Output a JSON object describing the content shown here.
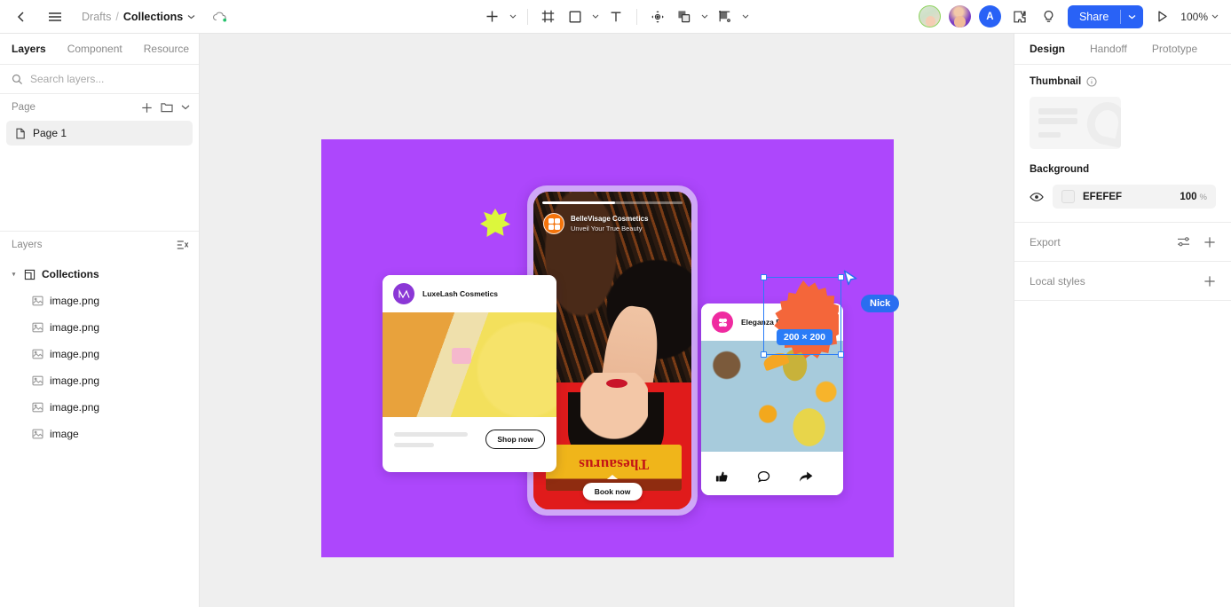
{
  "topbar": {
    "back_icon": "chevron-left-icon",
    "menu_icon": "hamburger-menu-icon",
    "breadcrumb": {
      "project": "Drafts",
      "separator": "/",
      "file": "Collections"
    },
    "cloud_icon": "cloud-saved-icon",
    "tools": [
      {
        "name": "add-tool",
        "glyph": "+",
        "has_dropdown": true
      },
      {
        "name": "frame-tool",
        "glyph": "frame",
        "has_dropdown": false
      },
      {
        "name": "shape-tool",
        "glyph": "rectangle",
        "has_dropdown": true
      },
      {
        "name": "text-tool",
        "glyph": "T",
        "has_dropdown": false
      },
      {
        "name": "move-tool",
        "glyph": "move",
        "has_dropdown": false
      },
      {
        "name": "boolean-tool",
        "glyph": "union",
        "has_dropdown": true
      },
      {
        "name": "mask-tool",
        "glyph": "mask",
        "has_dropdown": true
      }
    ],
    "avatars": [
      {
        "type": "photo"
      },
      {
        "type": "photo"
      },
      {
        "type": "initial",
        "label": "A"
      }
    ],
    "plugin_icon": "plugin-icon",
    "lightbulb_icon": "lightbulb-icon",
    "share_label": "Share",
    "present_icon": "play-present-icon",
    "zoom_level": "100%"
  },
  "left_panel": {
    "tabs": [
      {
        "label": "Layers",
        "active": true
      },
      {
        "label": "Component",
        "active": false
      },
      {
        "label": "Resource",
        "active": false
      }
    ],
    "search": {
      "placeholder": "Search layers...",
      "value": "",
      "icon": "search-icon"
    },
    "page_section": {
      "title": "Page",
      "add_icon": "plus-icon",
      "folder_icon": "folder-icon",
      "collapse_icon": "chevron-down-icon",
      "items": [
        {
          "label": "Page 1",
          "icon": "page-icon",
          "selected": true
        }
      ]
    },
    "layers_section": {
      "title": "Layers",
      "filter_icon": "layers-filter-icon",
      "group": {
        "label": "Collections",
        "icon": "frame-icon",
        "expanded": true
      },
      "children": [
        {
          "label": "image.png",
          "icon": "image-icon"
        },
        {
          "label": "image.png",
          "icon": "image-icon"
        },
        {
          "label": "image.png",
          "icon": "image-icon"
        },
        {
          "label": "image.png",
          "icon": "image-icon"
        },
        {
          "label": "image.png",
          "icon": "image-icon"
        },
        {
          "label": "image",
          "icon": "image-icon"
        }
      ]
    }
  },
  "canvas": {
    "background_color": "#EFEFEF",
    "artboard_color": "#AD47FC",
    "blob": {
      "name": "yellow-blob-shape",
      "color": "#DCF73C"
    },
    "phone_story": {
      "brand": "BelleVisage Cosmetics",
      "tagline": "Unveil Your True Beauty",
      "cta": "Book now",
      "book_title": "Thesaurus"
    },
    "card_left": {
      "brand": "LuxeLash Cosmetics",
      "cta": "Shop now"
    },
    "card_right": {
      "brand": "Eleganza Beauty",
      "actions": [
        {
          "name": "like-icon"
        },
        {
          "name": "comment-icon"
        },
        {
          "name": "share-icon"
        }
      ]
    },
    "selection": {
      "shape": "starburst",
      "shape_color": "#F4663A",
      "size_badge": "200 × 200",
      "handle_color": "#2A7CF7"
    },
    "collaborator_cursor": {
      "name": "Nick",
      "color": "#2A6EF0"
    }
  },
  "right_panel": {
    "tabs": [
      {
        "label": "Design",
        "active": true
      },
      {
        "label": "Handoff",
        "active": false
      },
      {
        "label": "Prototype",
        "active": false
      }
    ],
    "thumbnail": {
      "title": "Thumbnail",
      "info_icon": "info-icon"
    },
    "background": {
      "title": "Background",
      "visibility_icon": "eye-icon",
      "color_hex": "EFEFEF",
      "opacity_value": "100",
      "opacity_unit": "%"
    },
    "export": {
      "title": "Export",
      "settings_icon": "export-settings-icon",
      "add_icon": "plus-icon"
    },
    "local_styles": {
      "title": "Local styles",
      "add_icon": "plus-icon"
    }
  }
}
